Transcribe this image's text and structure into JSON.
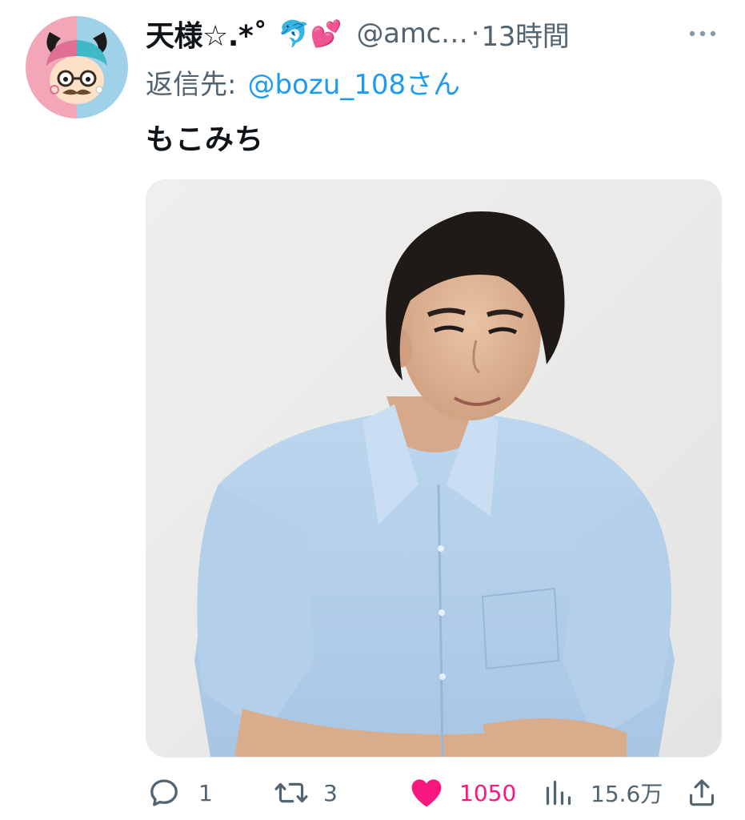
{
  "tweet": {
    "display_name": "天様☆.*˚",
    "name_emoji": "🐬💕",
    "handle": "@amc…",
    "separator": "·",
    "time": "13時間",
    "reply_label": "返信先:",
    "reply_mention": "@bozu_108さん",
    "text": "もこみち",
    "more_icon": "more-horizontal-icon",
    "media_alt": "photo"
  },
  "actions": {
    "reply_count": "1",
    "retweet_count": "3",
    "like_count": "1050",
    "views_count": "15.6万"
  },
  "colors": {
    "text_primary": "#0f1419",
    "text_secondary": "#536471",
    "link": "#1d9bf0",
    "like": "#f91880"
  }
}
